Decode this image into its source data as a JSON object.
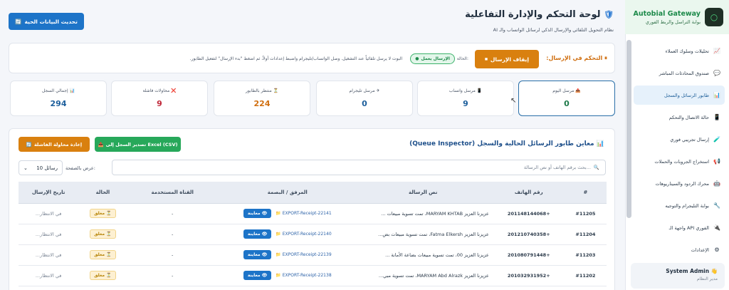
{
  "brand": {
    "title": "Autobial Gateway",
    "subtitle": "بوابة التراسل والربط الفوري",
    "logo_icon": "○"
  },
  "sidebar": {
    "items": [
      {
        "label": "تحليلات وسلوك العملاء",
        "icon": "📈"
      },
      {
        "label": "صندوق المحادثات المباشر",
        "icon": "💬"
      },
      {
        "label": "طابور الرسائل والسجل",
        "icon": "📊",
        "active": true
      },
      {
        "label": "حالة الاتصال والتحكم",
        "icon": "📱"
      },
      {
        "label": "إرسال تجريبي فوري",
        "icon": "🧪"
      },
      {
        "label": "استخراج الجروبات والحملات",
        "icon": "📢"
      },
      {
        "label": "محرك الردود والسيناريوهات",
        "icon": "🤖"
      },
      {
        "label": "بوابة التليجرام والتوجيه",
        "icon": "🔧"
      },
      {
        "label": "واجهة الـ API الفوري",
        "icon": "🔌"
      },
      {
        "label": "الإعدادات",
        "icon": "⚙"
      }
    ],
    "user": {
      "name": "System Admin 👋",
      "role": "مدير النظام"
    }
  },
  "header": {
    "title": "لوحة التحكم والإدارة التفاعلية",
    "title_icon": "🛡",
    "subtitle": "نظام التحويل التلقائي والإرسال الذكي لرسائل الواتساب والـ AI",
    "refresh_label": "تحديث البيانات الحية",
    "refresh_icon": "🔄"
  },
  "control": {
    "title": "التحكم في الإرسال:",
    "title_icon": "⏸",
    "stop_label": "إيقاف الإرسال",
    "stop_icon": "⏹",
    "state_label": "الحالة:",
    "state_badge": "الإرسال يعمل",
    "note": "البوت لا يرسل تلقائياً عند التشغيل. وصل الواتساب/تليجرام واضبط إعدادات أولاً، ثم اضغط \"بدء الإرسال\" لتفعيل الطابور."
  },
  "stats": [
    {
      "label": "مرسل اليوم",
      "icon": "📤",
      "value": "0",
      "color": "#1f7a4a",
      "active": true
    },
    {
      "label": "مرسل واتساب",
      "icon": "📱",
      "value": "9",
      "color": "#1d5f9c"
    },
    {
      "label": "مرسل تليجرام",
      "icon": "✈",
      "value": "0",
      "color": "#1d5f9c"
    },
    {
      "label": "منتظر بالطابور",
      "icon": "⏳",
      "value": "224",
      "color": "#d06f10"
    },
    {
      "label": "محاولات فاشلة",
      "icon": "❌",
      "value": "9",
      "color": "#c0283a"
    },
    {
      "label": "إجمالي السجل",
      "icon": "📊",
      "value": "294",
      "color": "#1d5f9c"
    }
  ],
  "queue": {
    "title": "معاين طابور الرسائل الحالية والسجل (Queue Inspector)",
    "title_icon": "📊",
    "export_label": "تصدير السجل إلى Excel (CSV)",
    "export_icon": "📥",
    "retry_label": "إعادة محاولة الفاشلة",
    "retry_icon": "🔄",
    "search_placeholder": "بحث برقم الهاتف أو نص الرسالة...",
    "search_icon": "🔍",
    "per_page_label": "عرض بالصفحة:",
    "per_page_value": "10 رسائل",
    "columns": [
      "#",
      "رقم الهاتف",
      "نص الرسالة",
      "المرفق / البصمة",
      "القناة المستخدمة",
      "الحالة",
      "تاريخ الإرسال"
    ],
    "rows": [
      {
        "id": "#11205",
        "phone": "+201148144068",
        "msg": "عزيزنا العزيز MARYAM KHTAB، تمت تسوية مبيعات ...",
        "att": "EXPORT-Receipt-22141 📁",
        "view": "معاينة",
        "channel": "-",
        "status": "معلق",
        "date": "في الانتظار..."
      },
      {
        "id": "#11204",
        "phone": "+201210740358",
        "msg": "عزيزنا العزيز Fatma Elkersh، تمت تسوية مبيعات بض...",
        "att": "EXPORT-Receipt-22140 📁",
        "view": "معاينة",
        "channel": "-",
        "status": "معلق",
        "date": "في الانتظار..."
      },
      {
        "id": "#11203",
        "phone": "+201080791448",
        "msg": "عزيزنا العزيز 00، تمت تسوية مبيعات بضاعة الأمانة ...",
        "att": "EXPORT-Receipt-22139 📁",
        "view": "معاينة",
        "channel": "-",
        "status": "معلق",
        "date": "في الانتظار..."
      },
      {
        "id": "#11202",
        "phone": "+201032931952",
        "msg": "عزيزنا العزيز MARYAM Abd Alrazk، تمت تسوية مبي...",
        "att": "EXPORT-Receipt-22138 📁",
        "view": "معاينة",
        "channel": "-",
        "status": "معلق",
        "date": "في الانتظار..."
      }
    ]
  },
  "colors": {
    "accent": "#1d74c8",
    "warning": "#d9800f",
    "success": "#27a85a",
    "danger": "#c0283a"
  }
}
